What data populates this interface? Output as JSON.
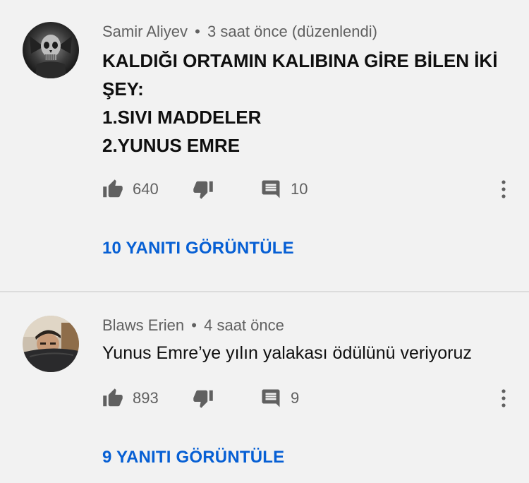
{
  "comments": [
    {
      "author": "Samir Aliyev",
      "separator": "•",
      "time": "3 saat önce (düzenlendi)",
      "lines": [
        "KALDIĞI ORTAMIN KALIBINA GİRE BİLEN İKİ",
        "ŞEY:",
        "1.SIVI MADDELER",
        "2.YUNUS EMRE"
      ],
      "likes": "640",
      "replies_count": "10",
      "view_replies": "10 YANITI GÖRÜNTÜLE"
    },
    {
      "author": "Blaws Erien",
      "separator": "•",
      "time": "4 saat önce",
      "text": "Yunus Emre’ye yılın yalakası ödülünü veriyoruz",
      "likes": "893",
      "replies_count": "9",
      "view_replies": "9 YANITI GÖRÜNTÜLE"
    }
  ],
  "icons": {
    "like": "thumbs-up-icon",
    "dislike": "thumbs-down-icon",
    "reply": "comment-icon",
    "more": "more-vertical-icon"
  },
  "colors": {
    "background": "#f2f2f2",
    "link": "#065fd4",
    "icon": "#606060"
  }
}
